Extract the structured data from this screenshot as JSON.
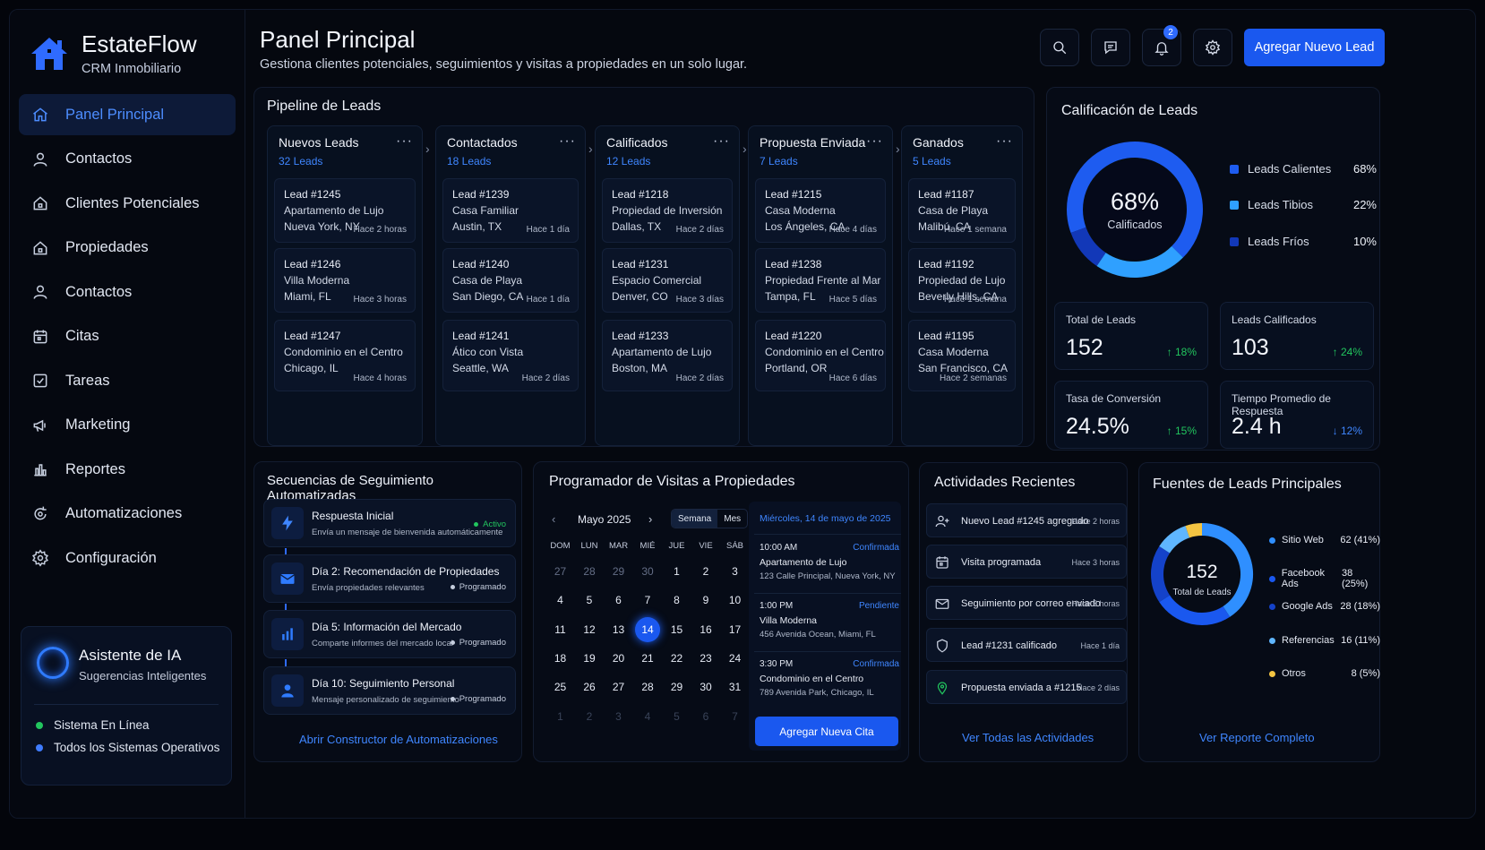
{
  "brand": {
    "name": "EstateFlow",
    "subtitle": "CRM Inmobiliario"
  },
  "nav": [
    {
      "label": "Panel Principal",
      "icon": "home-icon",
      "active": true
    },
    {
      "label": "Contactos",
      "icon": "user-icon"
    },
    {
      "label": "Clientes Potenciales",
      "icon": "house-icon"
    },
    {
      "label": "Propiedades",
      "icon": "house-icon"
    },
    {
      "label": "Contactos",
      "icon": "user-icon"
    },
    {
      "label": "Citas",
      "icon": "calendar-icon"
    },
    {
      "label": "Tareas",
      "icon": "checkbox-icon"
    },
    {
      "label": "Marketing",
      "icon": "megaphone-icon"
    },
    {
      "label": "Reportes",
      "icon": "bar-chart-icon"
    },
    {
      "label": "Automatizaciones",
      "icon": "refresh-gear-icon"
    },
    {
      "label": "Configuración",
      "icon": "gear-icon"
    }
  ],
  "ai_assistant": {
    "title": "Asistente de IA",
    "subtitle": "Sugerencias Inteligentes",
    "status_online": "Sistema En Línea",
    "status_ops": "Todos los Sistemas Operativos"
  },
  "header": {
    "title": "Panel Principal",
    "subtitle": "Gestiona clientes potenciales, seguimientos y visitas a propiedades en un solo lugar.",
    "notification_count": "2",
    "add_lead": "Agregar Nuevo Lead"
  },
  "pipeline": {
    "title": "Pipeline de Leads",
    "columns": [
      {
        "title": "Nuevos Leads",
        "count": "32 Leads",
        "cards": [
          {
            "id": "Lead #1245",
            "name": "Apartamento de Lujo",
            "loc": "Nueva York, NY",
            "time": "Hace 2 horas"
          },
          {
            "id": "Lead #1246",
            "name": "Villa Moderna",
            "loc": "Miami, FL",
            "time": "Hace 3 horas"
          },
          {
            "id": "Lead #1247",
            "name": "Condominio en el Centro",
            "loc": "Chicago, IL",
            "time": "Hace 4 horas"
          }
        ]
      },
      {
        "title": "Contactados",
        "count": "18 Leads",
        "cards": [
          {
            "id": "Lead #1239",
            "name": "Casa Familiar",
            "loc": "Austin, TX",
            "time": "Hace 1 día"
          },
          {
            "id": "Lead #1240",
            "name": "Casa de Playa",
            "loc": "San Diego, CA",
            "time": "Hace 1 día"
          },
          {
            "id": "Lead #1241",
            "name": "Ático con Vista",
            "loc": "Seattle, WA",
            "time": "Hace 2 días"
          }
        ]
      },
      {
        "title": "Calificados",
        "count": "12 Leads",
        "cards": [
          {
            "id": "Lead #1218",
            "name": "Propiedad de Inversión",
            "loc": "Dallas, TX",
            "time": "Hace 2 días"
          },
          {
            "id": "Lead #1231",
            "name": "Espacio Comercial",
            "loc": "Denver, CO",
            "time": "Hace 3 días"
          },
          {
            "id": "Lead #1233",
            "name": "Apartamento de Lujo",
            "loc": "Boston, MA",
            "time": "Hace 2 días"
          }
        ]
      },
      {
        "title": "Propuesta Enviada",
        "count": "7 Leads",
        "cards": [
          {
            "id": "Lead #1215",
            "name": "Casa Moderna",
            "loc": "Los Ángeles, CA",
            "time": "Hace 4 días"
          },
          {
            "id": "Lead #1238",
            "name": "Propiedad Frente al Mar",
            "loc": "Tampa, FL",
            "time": "Hace 5 días"
          },
          {
            "id": "Lead #1220",
            "name": "Condominio en el Centro",
            "loc": "Portland, OR",
            "time": "Hace 6 días"
          }
        ]
      },
      {
        "title": "Ganados",
        "count": "5 Leads",
        "cards": [
          {
            "id": "Lead #1187",
            "name": "Casa de Playa",
            "loc": "Malibú, CA",
            "time": "Hace 1 semana"
          },
          {
            "id": "Lead #1192",
            "name": "Propiedad de Lujo",
            "loc": "Beverly Hills, CA",
            "time": "Hace 1 semana"
          },
          {
            "id": "Lead #1195",
            "name": "Casa Moderna",
            "loc": "San Francisco, CA",
            "time": "Hace 2 semanas"
          }
        ]
      }
    ]
  },
  "rating": {
    "title": "Calificación de Leads",
    "center_value": "68%",
    "center_label": "Calificados",
    "segments": [
      {
        "label": "Leads Calientes",
        "pct": "68%",
        "value": 68,
        "color": "#1e5cf0"
      },
      {
        "label": "Leads Tibios",
        "pct": "22%",
        "value": 22,
        "color": "#2fa0ff"
      },
      {
        "label": "Leads Fríos",
        "pct": "10%",
        "value": 10,
        "color": "#1238b8"
      }
    ],
    "stats": [
      {
        "label": "Total de Leads",
        "value": "152",
        "delta": "↑ 18%",
        "color": "#22c55e"
      },
      {
        "label": "Leads Calificados",
        "value": "103",
        "delta": "↑ 24%",
        "color": "#22c55e"
      },
      {
        "label": "Tasa de Conversión",
        "value": "24.5%",
        "delta": "↑ 15%",
        "color": "#22c55e"
      },
      {
        "label": "Tiempo Promedio de Respuesta",
        "value": "2.4 h",
        "delta": "↓ 12%",
        "color": "#3f86ff"
      }
    ]
  },
  "sequences": {
    "title": "Secuencias de Seguimiento Automatizadas",
    "items": [
      {
        "title": "Respuesta Inicial",
        "desc": "Envía un mensaje de bienvenida automáticamente",
        "status": "Activo",
        "icon": "lightning-icon",
        "status_color": "#22c55e"
      },
      {
        "title": "Día 2: Recomendación de Propiedades",
        "desc": "Envía propiedades relevantes",
        "status": "Programado",
        "icon": "envelope-icon",
        "status_color": "#c5cddd"
      },
      {
        "title": "Día 5: Información del Mercado",
        "desc": "Comparte informes del mercado local",
        "status": "Programado",
        "icon": "bar-chart-icon",
        "status_color": "#c5cddd"
      },
      {
        "title": "Día 10: Seguimiento Personal",
        "desc": "Mensaje personalizado de seguimiento",
        "status": "Programado",
        "icon": "person-icon",
        "status_color": "#c5cddd"
      }
    ],
    "link": "Abrir Constructor de Automatizaciones"
  },
  "scheduler": {
    "title": "Programador de Visitas a Propiedades",
    "month": "Mayo 2025",
    "view_week": "Semana",
    "view_month": "Mes",
    "dow": [
      "DOM",
      "LUN",
      "MAR",
      "MIÉ",
      "JUE",
      "VIE",
      "SÁB"
    ],
    "weeks": [
      [
        "27",
        "28",
        "29",
        "30",
        "1",
        "2",
        "3"
      ],
      [
        "4",
        "5",
        "6",
        "7",
        "8",
        "9",
        "10"
      ],
      [
        "11",
        "12",
        "13",
        "14",
        "15",
        "16",
        "17"
      ],
      [
        "18",
        "19",
        "20",
        "21",
        "22",
        "23",
        "24"
      ],
      [
        "25",
        "26",
        "27",
        "28",
        "29",
        "30",
        "31"
      ],
      [
        "1",
        "2",
        "3",
        "4",
        "5",
        "6",
        "7"
      ]
    ],
    "selected_date": "Miércoles, 14 de mayo de 2025",
    "appointments": [
      {
        "time": "10:00 AM",
        "status": "Confirmada",
        "status_color": "#3f86ff",
        "name": "Apartamento de Lujo",
        "addr": "123 Calle Principal, Nueva York, NY"
      },
      {
        "time": "1:00 PM",
        "status": "Pendiente",
        "status_color": "#3f86ff",
        "name": "Villa Moderna",
        "addr": "456 Avenida Ocean, Miami, FL"
      },
      {
        "time": "3:30 PM",
        "status": "Confirmada",
        "status_color": "#3f86ff",
        "name": "Condominio en el Centro",
        "addr": "789 Avenida Park, Chicago, IL"
      }
    ],
    "add_button": "Agregar Nueva Cita"
  },
  "activities": {
    "title": "Actividades Recientes",
    "items": [
      {
        "text": "Nuevo Lead #1245 agregado",
        "time": "Hace 2 horas",
        "icon": "person-add-icon"
      },
      {
        "text": "Visita programada",
        "time": "Hace 3 horas",
        "icon": "calendar-icon"
      },
      {
        "text": "Seguimiento por correo enviado",
        "time": "Hace 5 horas",
        "icon": "envelope-icon"
      },
      {
        "text": "Lead #1231 calificado",
        "time": "Hace 1 día",
        "icon": "shield-icon"
      },
      {
        "text": "Propuesta enviada a #1215",
        "time": "Hace 2 días",
        "icon": "location-pin-icon"
      }
    ],
    "link": "Ver Todas las Actividades"
  },
  "sources": {
    "title": "Fuentes de Leads Principales",
    "center_value": "152",
    "center_label": "Total de Leads",
    "items": [
      {
        "label": "Sitio Web",
        "value": "62 (41%)",
        "num": 62,
        "color": "#2f8fff"
      },
      {
        "label": "Facebook Ads",
        "value": "38 (25%)",
        "num": 38,
        "color": "#1a58ef"
      },
      {
        "label": "Google Ads",
        "value": "28 (18%)",
        "num": 28,
        "color": "#1442c9"
      },
      {
        "label": "Referencias",
        "value": "16 (11%)",
        "num": 16,
        "color": "#5fb6ff"
      },
      {
        "label": "Otros",
        "value": "8 (5%)",
        "num": 8,
        "color": "#f4c542"
      }
    ],
    "link": "Ver Reporte Completo"
  }
}
